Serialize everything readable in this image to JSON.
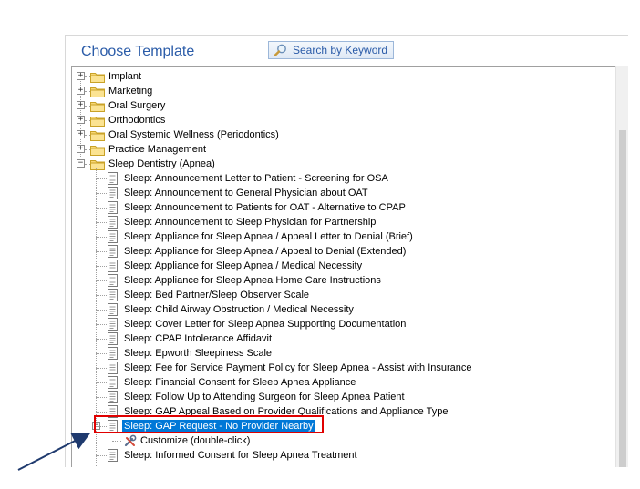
{
  "header": {
    "title": "Choose Template",
    "search_button": "Search by Keyword"
  },
  "tree": {
    "folders": [
      {
        "label": "Implant",
        "expanded": false
      },
      {
        "label": "Marketing",
        "expanded": false
      },
      {
        "label": "Oral Surgery",
        "expanded": false
      },
      {
        "label": "Orthodontics",
        "expanded": false
      },
      {
        "label": "Oral Systemic Wellness (Periodontics)",
        "expanded": false
      },
      {
        "label": "Practice Management",
        "expanded": false
      },
      {
        "label": "Sleep Dentistry (Apnea)",
        "expanded": true
      }
    ],
    "sleep_items": [
      "Sleep: Announcement Letter to Patient - Screening for OSA",
      "Sleep: Announcement to General Physician about OAT",
      "Sleep: Announcement to Patients for OAT - Alternative to CPAP",
      "Sleep: Announcement to Sleep Physician for Partnership",
      "Sleep: Appliance for Sleep Apnea / Appeal Letter to Denial (Brief)",
      "Sleep: Appliance for Sleep Apnea / Appeal to Denial (Extended)",
      "Sleep: Appliance for Sleep Apnea / Medical Necessity",
      "Sleep: Appliance for Sleep Apnea Home Care Instructions",
      "Sleep: Bed Partner/Sleep Observer Scale",
      "Sleep: Child Airway Obstruction / Medical Necessity",
      "Sleep: Cover Letter for Sleep Apnea Supporting Documentation",
      "Sleep: CPAP Intolerance Affidavit",
      "Sleep: Epworth Sleepiness Scale",
      "Sleep: Fee for Service Payment Policy for Sleep Apnea - Assist with Insurance",
      "Sleep: Financial Consent for Sleep Apnea Appliance",
      "Sleep: Follow Up to Attending Surgeon for Sleep Apnea Patient",
      "Sleep: GAP Appeal Based on Provider Qualifications and Appliance Type"
    ],
    "selected_item": "Sleep: GAP Request - No Provider Nearby",
    "child_item": "Customize (double-click)",
    "after_items": [
      "Sleep: Informed Consent for Sleep Apnea Treatment"
    ]
  },
  "colors": {
    "title": "#2a5ba8",
    "selection": "#0078d7",
    "highlight_box": "#e00000",
    "arrow": "#1f3a6e"
  }
}
